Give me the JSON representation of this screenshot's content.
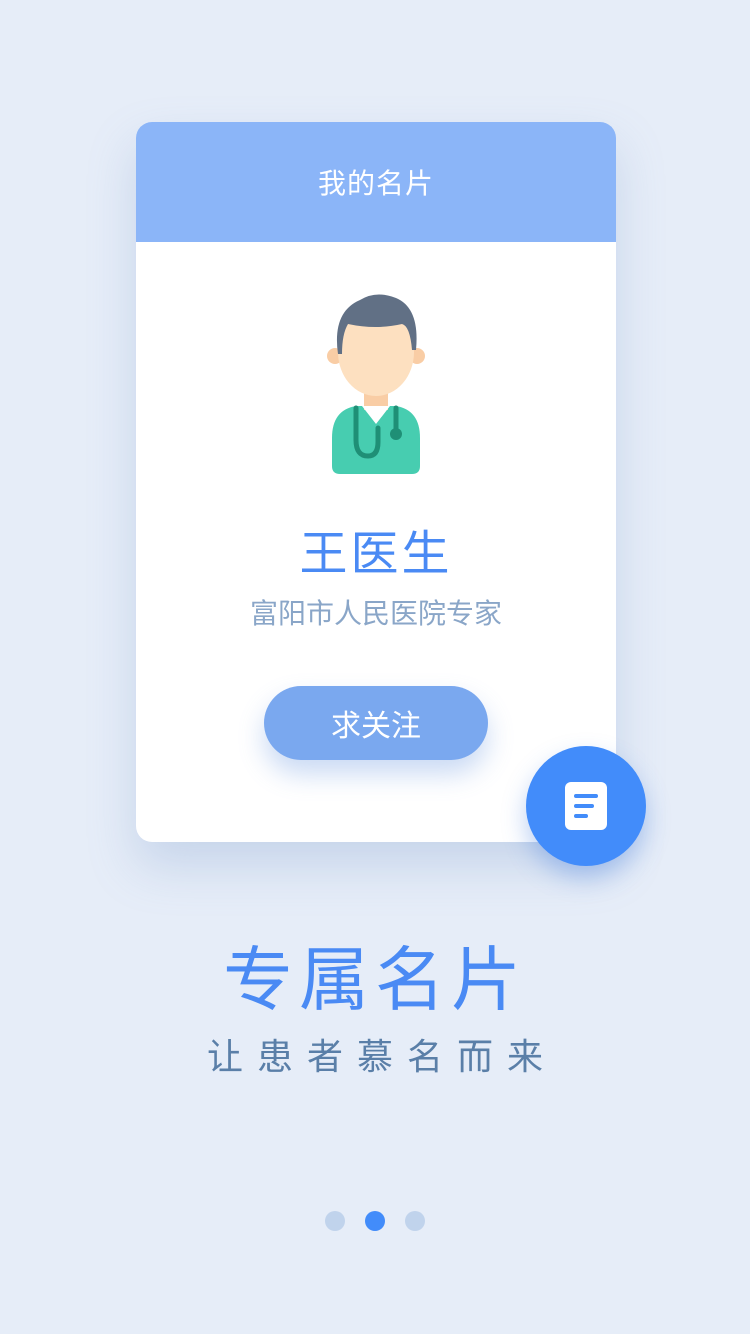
{
  "card": {
    "title": "我的名片",
    "doctor_name": "王医生",
    "hospital": "富阳市人民医院专家",
    "follow_label": "求关注"
  },
  "fab": {
    "icon": "document-icon"
  },
  "intro": {
    "headline": "专属名片",
    "tagline": "让患者慕名而来"
  },
  "pager": {
    "total": 3,
    "active": 2
  },
  "colors": {
    "background": "#e6edf8",
    "header": "#8bb5f8",
    "accent": "#428cfa",
    "button": "#7aa8ef",
    "subtitle": "#8aa6c8"
  }
}
